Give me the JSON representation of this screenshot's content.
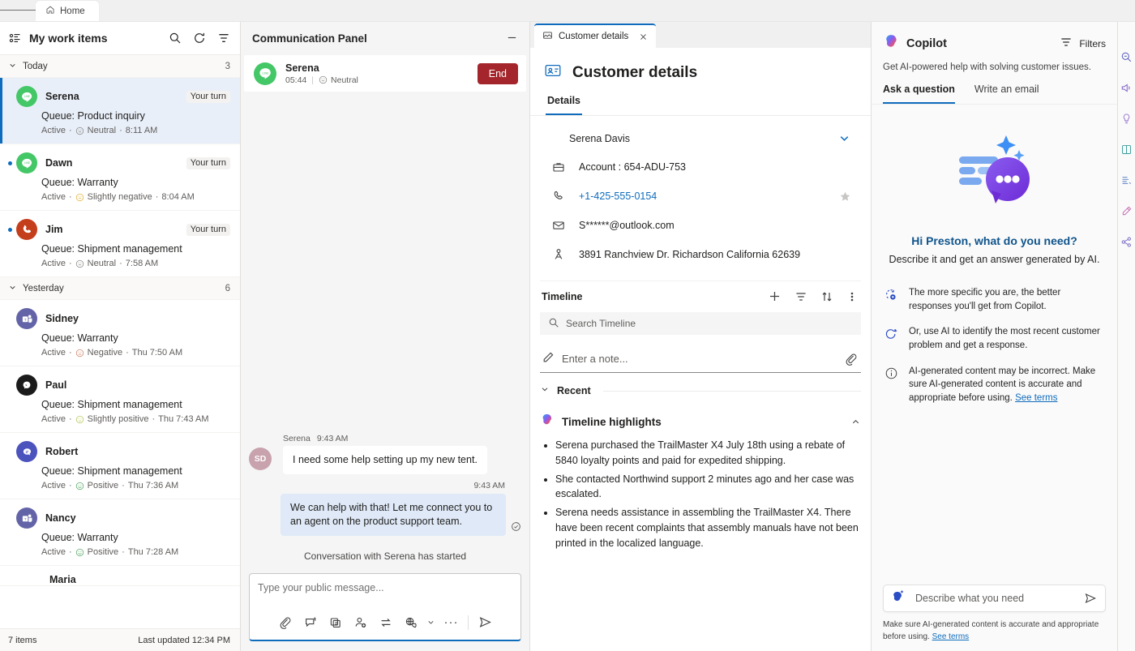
{
  "topbar": {
    "home_label": "Home",
    "hamburger_icon": "hamburger-menu-icon",
    "home_icon": "home-icon"
  },
  "workitems": {
    "title": "My work items",
    "header_icons": [
      "search-icon",
      "refresh-icon",
      "filter-icon"
    ],
    "groups": [
      {
        "label": "Today",
        "count": "3"
      },
      {
        "label": "Yesterday",
        "count": "6"
      }
    ],
    "items": [
      {
        "name": "Serena",
        "turn": "Your turn",
        "queue": "Queue: Product inquiry",
        "status": "Active",
        "sentiment": "Neutral",
        "time": "8:11 AM",
        "channel": "line",
        "selected": true,
        "unread": false
      },
      {
        "name": "Dawn",
        "turn": "Your turn",
        "queue": "Queue: Warranty",
        "status": "Active",
        "sentiment": "Slightly negative",
        "time": "8:04 AM",
        "channel": "line",
        "selected": false,
        "unread": true
      },
      {
        "name": "Jim",
        "turn": "Your turn",
        "queue": "Queue: Shipment management",
        "status": "Active",
        "sentiment": "Neutral",
        "time": "7:58 AM",
        "channel": "voice",
        "selected": false,
        "unread": true
      },
      {
        "name": "Sidney",
        "turn": "",
        "queue": "Queue: Warranty",
        "status": "Active",
        "sentiment": "Negative",
        "time": "Thu 7:50 AM",
        "channel": "teams",
        "selected": false,
        "unread": false
      },
      {
        "name": "Paul",
        "turn": "",
        "queue": "Queue: Shipment management",
        "status": "Active",
        "sentiment": "Slightly positive",
        "time": "Thu 7:43 AM",
        "channel": "messenger",
        "selected": false,
        "unread": false
      },
      {
        "name": "Robert",
        "turn": "",
        "queue": "Queue: Shipment management",
        "status": "Active",
        "sentiment": "Positive",
        "time": "Thu 7:36 AM",
        "channel": "chat",
        "selected": false,
        "unread": false
      },
      {
        "name": "Nancy",
        "turn": "",
        "queue": "Queue: Warranty",
        "status": "Active",
        "sentiment": "Positive",
        "time": "Thu 7:28 AM",
        "channel": "teams",
        "selected": false,
        "unread": false
      },
      {
        "name": "Maria",
        "turn": "",
        "queue": "",
        "status": "",
        "sentiment": "",
        "time": "",
        "channel": "none",
        "selected": false,
        "unread": false
      }
    ],
    "footer": {
      "count": "7 items",
      "updated": "Last updated 12:34 PM"
    }
  },
  "communication": {
    "panel_title": "Communication Panel",
    "minimize_icon": "minimize-icon",
    "customer": {
      "name": "Serena",
      "duration": "05:44",
      "sentiment": "Neutral",
      "channel": "line"
    },
    "end_label": "End",
    "messages": [
      {
        "dir": "in",
        "author": "Serena",
        "time": "9:43 AM",
        "initials": "SD",
        "text": "I need some help setting up my new tent."
      },
      {
        "dir": "out",
        "author": "",
        "time": "9:43 AM",
        "initials": "",
        "text": "We can help with that! Let me connect you to an agent on the product support team."
      }
    ],
    "system_line": "Conversation with Serena has started",
    "composer": {
      "placeholder": "Type your public message...",
      "tools": [
        "attach-icon",
        "quick-reply-icon",
        "knowledge-article-icon",
        "add-person-icon",
        "transfer-icon",
        "translate-icon",
        "chevron-down-icon",
        "more-options-icon",
        "send-icon"
      ]
    }
  },
  "customer_details": {
    "tab": {
      "label": "Customer details",
      "icon": "card-icon",
      "close_icon": "close-icon"
    },
    "page_title": "Customer details",
    "page_icon": "contact-card-icon",
    "subtabs": [
      {
        "label": "Details",
        "active": true
      }
    ],
    "contact": {
      "name": "Serena Davis",
      "expand_icon": "chevron-down-icon",
      "fields": [
        {
          "icon": "briefcase-icon",
          "value": "Account : 654-ADU-753",
          "link": false,
          "star": false
        },
        {
          "icon": "phone-icon",
          "value": "+1-425-555-0154",
          "link": true,
          "star": true
        },
        {
          "icon": "envelope-icon",
          "value": "S******@outlook.com",
          "link": false,
          "star": false
        },
        {
          "icon": "location-icon",
          "value": "3891 Ranchview Dr. Richardson California 62639",
          "link": false,
          "star": false
        }
      ]
    },
    "timeline": {
      "title": "Timeline",
      "actions": [
        "add-icon",
        "filter-icon",
        "sort-icon",
        "more-options-icon"
      ],
      "search_placeholder": "Search Timeline",
      "note_placeholder": "Enter a note...",
      "note_attach_icon": "attach-icon",
      "recent_label": "Recent",
      "highlights_title": "Timeline highlights",
      "highlights": [
        "Serena purchased the TrailMaster X4 July 18th using a rebate of 5840 loyalty points and paid for expedited shipping.",
        "She contacted Northwind support 2 minutes ago and her case was escalated.",
        "Serena needs assistance in assembling the TrailMaster X4. There have been recent complaints that assembly manuals have not been printed in the localized language."
      ]
    }
  },
  "copilot": {
    "title": "Copilot",
    "logo_icon": "copilot-icon",
    "filters_label": "Filters",
    "filters_icon": "filter-icon",
    "subtitle": "Get AI-powered help with solving customer issues.",
    "tabs": [
      {
        "label": "Ask a question",
        "active": true
      },
      {
        "label": "Write an email",
        "active": false
      }
    ],
    "hero": {
      "heading": "Hi Preston, what do you need?",
      "body": "Describe it and get an answer generated by AI.",
      "illustration": "copilot-chat-illustration"
    },
    "tips": [
      {
        "icon": "target-idea-icon",
        "text": "The more specific you are, the better responses you'll get from Copilot."
      },
      {
        "icon": "ai-refresh-icon",
        "text": "Or, use AI to identify the most recent customer problem and get a response."
      },
      {
        "icon": "info-icon",
        "text": "AI-generated content may be incorrect. Make sure AI-generated content is accurate and appropriate before using.",
        "link_text": "See terms"
      }
    ],
    "input": {
      "placeholder": "Describe what you need",
      "icon": "copilot-badge-icon",
      "send_icon": "send-icon"
    },
    "disclaimer": "Make sure AI-generated content is accurate and appropriate before using.",
    "disclaimer_link": "See terms"
  },
  "rail": {
    "icons": [
      "copilot-rail-icon",
      "announcement-icon",
      "knowledge-icon",
      "book-icon",
      "agent-scripts-icon",
      "smart-assist-icon",
      "share-icon"
    ]
  },
  "colors": {
    "accent": "#0f6cbd",
    "selected_row": "#e9eff9",
    "end_button": "#a4262c",
    "line_green": "#44c767",
    "voice_red": "#c43e1c",
    "teams_purple": "#6264a7",
    "messenger_black": "#1b1b1b",
    "chat_indigo": "#4b53bc",
    "sentiment_neutral": "#8a8886",
    "sentiment_negative": "#d2846b",
    "sentiment_slightly_negative": "#e3b23c",
    "sentiment_positive": "#59a869",
    "sentiment_slightly_positive": "#b8c95b",
    "copilot_heading": "#0f548c"
  }
}
